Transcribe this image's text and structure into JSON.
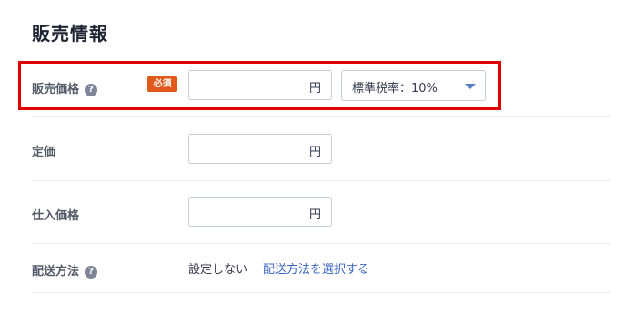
{
  "section_title": "販売情報",
  "sale_price": {
    "label": "販売価格",
    "help_icon": "?",
    "badge": "必須",
    "unit": "円",
    "value": "",
    "tax_rate": {
      "selected": "標準税率：10%",
      "caret_icon": "chevron-down-icon"
    }
  },
  "list_price": {
    "label": "定価",
    "unit": "円",
    "value": ""
  },
  "purchase_price": {
    "label": "仕入価格",
    "unit": "円",
    "value": ""
  },
  "shipping": {
    "label": "配送方法",
    "help_icon": "?",
    "status": "設定しない",
    "link": "配送方法を選択する"
  },
  "colors": {
    "highlight": "#e00000",
    "badge": "#e0581a",
    "link": "#3b66c4",
    "caret": "#5d7ec5"
  }
}
